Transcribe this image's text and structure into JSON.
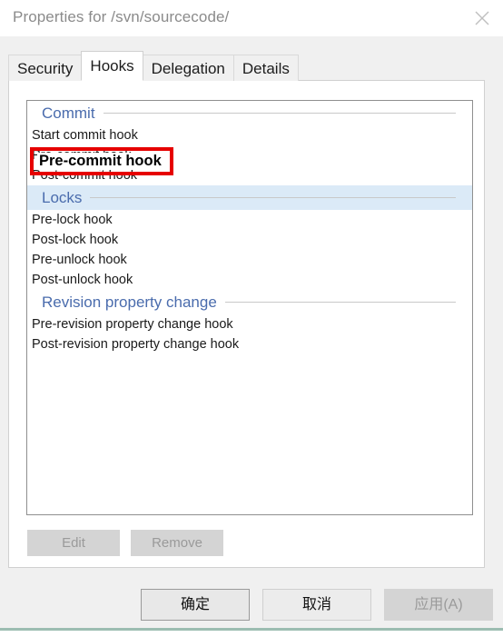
{
  "window": {
    "title": "Properties for /svn/sourcecode/",
    "close_icon": "close-icon"
  },
  "tabs": [
    {
      "label": "Security",
      "selected": false
    },
    {
      "label": "Hooks",
      "selected": true
    },
    {
      "label": "Delegation",
      "selected": false
    },
    {
      "label": "Details",
      "selected": false
    }
  ],
  "hook_groups": [
    {
      "title": "Commit",
      "banded": false,
      "items": [
        "Start commit hook",
        "Pre-commit hook",
        "Post-commit hook"
      ]
    },
    {
      "title": "Locks",
      "banded": true,
      "items": [
        "Pre-lock hook",
        "Post-lock hook",
        "Pre-unlock hook",
        "Post-unlock hook"
      ]
    },
    {
      "title": "Revision property change",
      "banded": false,
      "items": [
        "Pre-revision property change hook",
        "Post-revision property change hook"
      ]
    }
  ],
  "annotation": {
    "label": "Pre-commit hook",
    "border_color": "#e60000"
  },
  "panel_buttons": {
    "edit": "Edit",
    "remove": "Remove"
  },
  "footer_buttons": {
    "ok": "确定",
    "cancel": "取消",
    "apply": "应用(A)"
  },
  "colors": {
    "group_title": "#4a6cad",
    "band": "#dbeaf7",
    "annotation": "#e60000",
    "accent_rule": "#9cbdb1"
  }
}
